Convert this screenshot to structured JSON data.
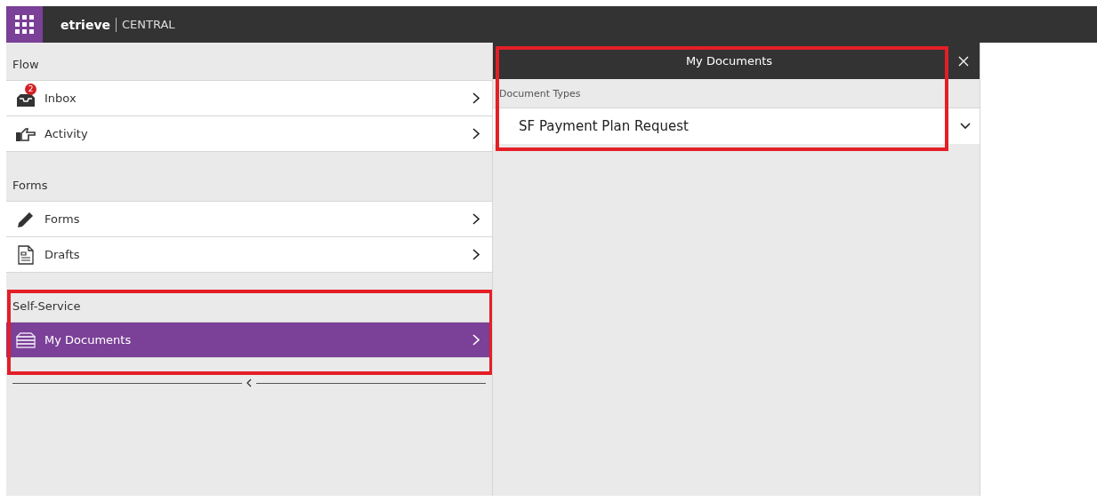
{
  "app_bar": {
    "brand": "etrieve",
    "product": "CENTRAL"
  },
  "sections": [
    {
      "heading": "Flow",
      "highlighted": false,
      "items": [
        {
          "kind": "inbox",
          "label": "Inbox",
          "badge": "2",
          "selected": false
        },
        {
          "kind": "pointer",
          "label": "Activity",
          "selected": false
        }
      ]
    },
    {
      "heading": "Forms",
      "highlighted": false,
      "items": [
        {
          "kind": "pencil",
          "label": "Forms",
          "selected": false
        },
        {
          "kind": "document",
          "label": "Drafts",
          "selected": false
        }
      ]
    },
    {
      "heading": "Self-Service",
      "highlighted": true,
      "items": [
        {
          "kind": "stack",
          "label": "My Documents",
          "selected": true
        }
      ]
    }
  ],
  "panel": {
    "title": "My Documents",
    "highlighted": true,
    "field_label": "Document Types",
    "select_value": "SF Payment Plan Request"
  }
}
